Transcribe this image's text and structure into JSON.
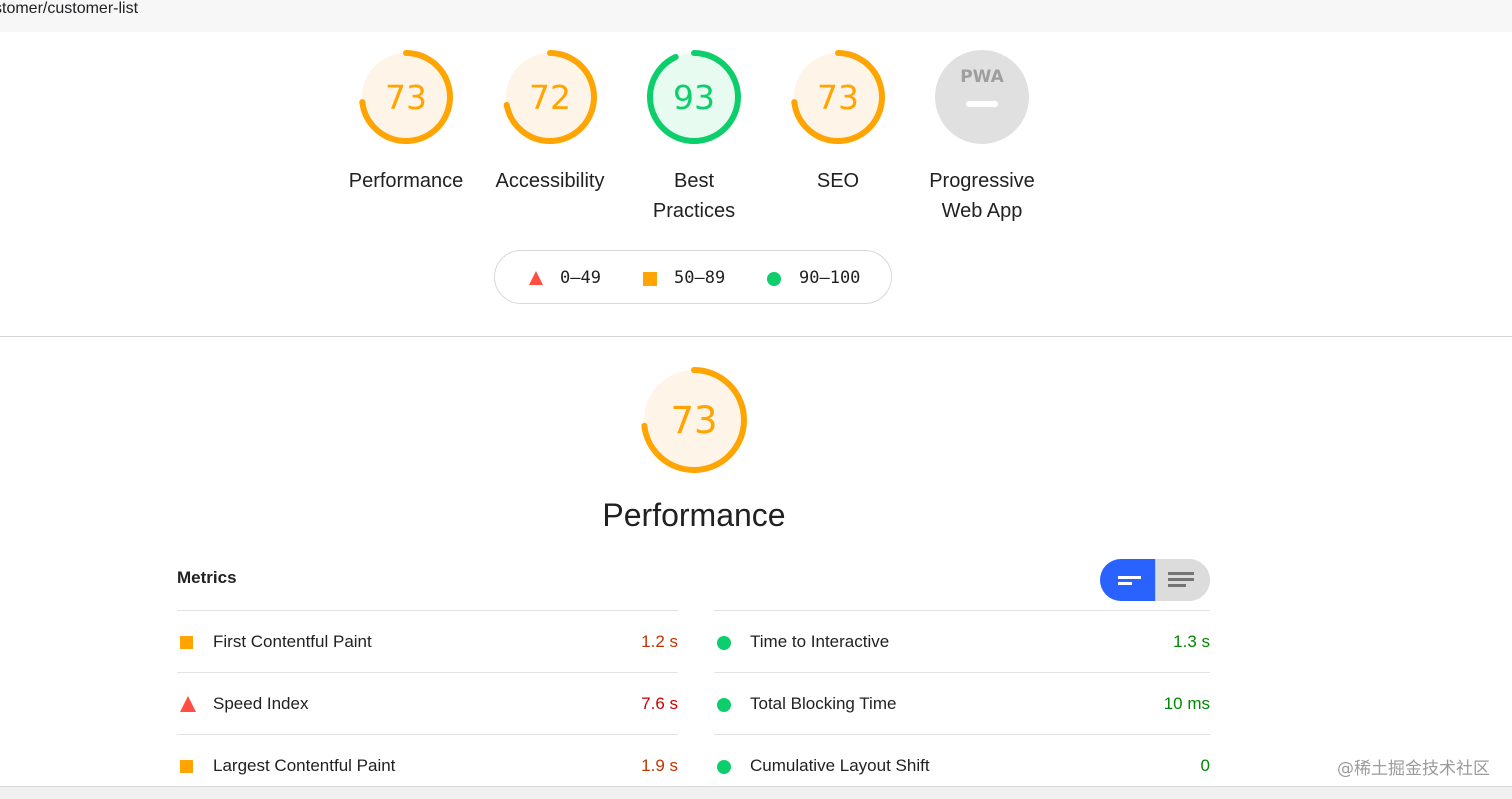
{
  "url_bar": {
    "text": "stomer/customer-list"
  },
  "gauges": [
    {
      "score": "73",
      "score_value": 73,
      "label": "Performance",
      "status": "average"
    },
    {
      "score": "72",
      "score_value": 72,
      "label": "Accessibility",
      "status": "average"
    },
    {
      "score": "93",
      "score_value": 93,
      "label": "Best Practices",
      "label_lines": [
        "Best",
        "Practices"
      ],
      "status": "pass"
    },
    {
      "score": "73",
      "score_value": 73,
      "label": "SEO",
      "status": "average"
    },
    {
      "label": "Progressive Web App",
      "label_lines": [
        "Progressive",
        "Web App"
      ],
      "status": "na",
      "icon": "pwa-badge-icon",
      "badge_text": "PWA"
    }
  ],
  "legend": [
    {
      "shape": "triangle",
      "range": "0–49",
      "color": "#ff4e42"
    },
    {
      "shape": "square",
      "range": "50–89",
      "color": "#ffa400"
    },
    {
      "shape": "circle",
      "range": "90–100",
      "color": "#0cce6b"
    }
  ],
  "performance_section": {
    "score": "73",
    "score_value": 73,
    "title": "Performance"
  },
  "metrics": {
    "title": "Metrics",
    "left": [
      {
        "name": "First Contentful Paint",
        "value": "1.2 s",
        "status": "average"
      },
      {
        "name": "Speed Index",
        "value": "7.6 s",
        "status": "fail"
      },
      {
        "name": "Largest Contentful Paint",
        "value": "1.9 s",
        "status": "average"
      }
    ],
    "right": [
      {
        "name": "Time to Interactive",
        "value": "1.3 s",
        "status": "pass"
      },
      {
        "name": "Total Blocking Time",
        "value": "10 ms",
        "status": "pass"
      },
      {
        "name": "Cumulative Layout Shift",
        "value": "0",
        "status": "pass"
      }
    ],
    "toggle": {
      "left_icon": "compact-view-icon",
      "right_icon": "expanded-view-icon",
      "active": "left"
    }
  },
  "colors": {
    "average": "#ffa400",
    "average_text": "#c33300",
    "average_bg": "#fff4e8",
    "pass": "#0cce6b",
    "pass_text": "#008800",
    "pass_bg": "#e7fbf0",
    "fail": "#ff4e42",
    "fail_text": "#cc0000",
    "na": "#e0e0e0",
    "toggle_active": "#2962ff"
  },
  "watermark": "@稀土掘金技术社区"
}
